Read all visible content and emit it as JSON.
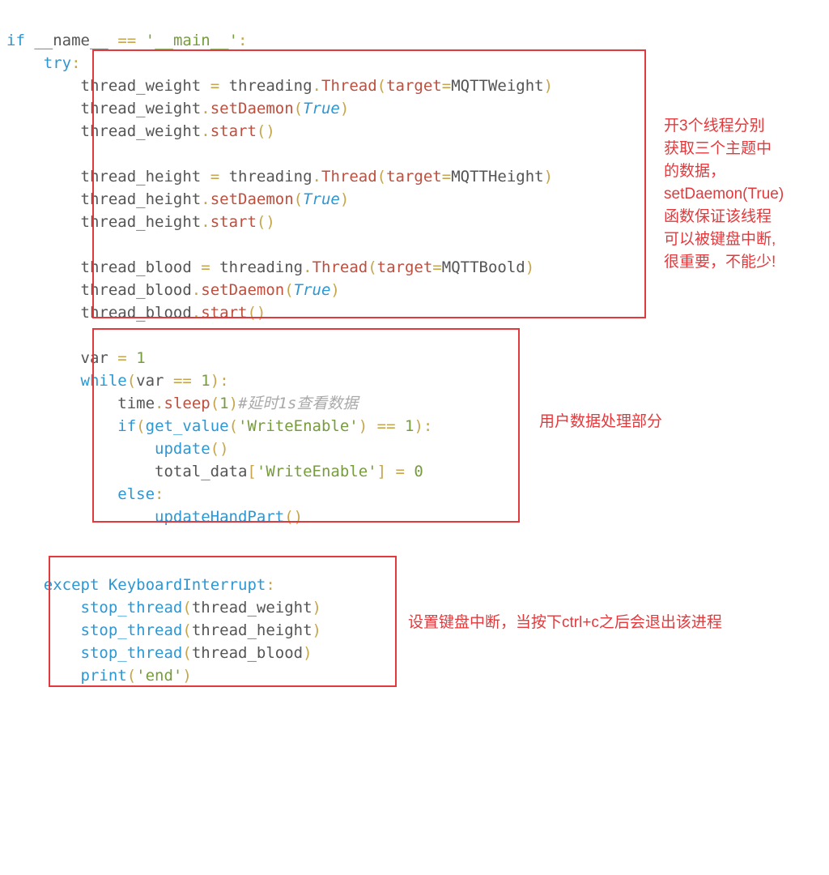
{
  "code": {
    "l01_if": "if",
    "l01_name": "__name__",
    "l01_eq": "==",
    "l01_main": "'__main__'",
    "l01_colon": ":",
    "l02_try": "try",
    "l02_colon": ":",
    "l03_tw": "thread_weight",
    "l03_eqB": "=",
    "l03_thrd": "threading",
    "l03_dot": ".",
    "l03_Thread": "Thread",
    "l03_lp": "(",
    "l03_target": "target",
    "l03_eq2": "=",
    "l03_fn": "MQTTWeight",
    "l03_rp": ")",
    "l04_tw": "thread_weight",
    "l04_dot": ".",
    "l04_sd": "setDaemon",
    "l04_lp": "(",
    "l04_true": "True",
    "l04_rp": ")",
    "l05_tw": "thread_weight",
    "l05_dot": ".",
    "l05_start": "start",
    "l05_lp": "(",
    "l05_rp": ")",
    "l07_th": "thread_height",
    "l07_eqB": "=",
    "l07_thrd": "threading",
    "l07_dot": ".",
    "l07_Thread": "Thread",
    "l07_lp": "(",
    "l07_target": "target",
    "l07_eq2": "=",
    "l07_fn": "MQTTHeight",
    "l07_rp": ")",
    "l08_th": "thread_height",
    "l08_dot": ".",
    "l08_sd": "setDaemon",
    "l08_lp": "(",
    "l08_true": "True",
    "l08_rp": ")",
    "l09_th": "thread_height",
    "l09_dot": ".",
    "l09_start": "start",
    "l09_lp": "(",
    "l09_rp": ")",
    "l11_tb": "thread_blood",
    "l11_eqB": "=",
    "l11_thrd": "threading",
    "l11_dot": ".",
    "l11_Thread": "Thread",
    "l11_lp": "(",
    "l11_target": "target",
    "l11_eq2": "=",
    "l11_fn": "MQTTBoold",
    "l11_rp": ")",
    "l12_tb": "thread_blood",
    "l12_dot": ".",
    "l12_sd": "setDaemon",
    "l12_lp": "(",
    "l12_true": "True",
    "l12_rp": ")",
    "l13_tb": "thread_blood",
    "l13_dot": ".",
    "l13_start": "start",
    "l13_lp": "(",
    "l13_rp": ")",
    "l15_var": "var",
    "l15_eq": "=",
    "l15_one": "1",
    "l16_while": "while",
    "l16_lp": "(",
    "l16_var": "var",
    "l16_eq": "==",
    "l16_one": "1",
    "l16_rp": ")",
    "l16_colon": ":",
    "l17_time": "time",
    "l17_dot": ".",
    "l17_sleep": "sleep",
    "l17_lp": "(",
    "l17_one": "1",
    "l17_rp": ")",
    "l17_cmt": "#延时1s查看数据",
    "l18_if": "if",
    "l18_lp": "(",
    "l18_gv": "get_value",
    "l18_lp2": "(",
    "l18_we": "'WriteEnable'",
    "l18_rp2": ")",
    "l18_eq": "==",
    "l18_one": "1",
    "l18_rp": ")",
    "l18_colon": ":",
    "l19_upd": "update",
    "l19_lp": "(",
    "l19_rp": ")",
    "l20_td": "total_data",
    "l20_lb": "[",
    "l20_we": "'WriteEnable'",
    "l20_rb": "]",
    "l20_eq": "=",
    "l20_zero": "0",
    "l21_else": "else",
    "l21_colon": ":",
    "l22_uhp": "updateHandPart",
    "l22_lp": "(",
    "l22_rp": ")",
    "l25_except": "except",
    "l25_ki": "KeyboardInterrupt",
    "l25_colon": ":",
    "l26_st": "stop_thread",
    "l26_lp": "(",
    "l26_arg": "thread_weight",
    "l26_rp": ")",
    "l27_st": "stop_thread",
    "l27_lp": "(",
    "l27_arg": "thread_height",
    "l27_rp": ")",
    "l28_st": "stop_thread",
    "l28_lp": "(",
    "l28_arg": "thread_blood",
    "l28_rp": ")",
    "l29_print": "print",
    "l29_lp": "(",
    "l29_end": "'end'",
    "l29_rp": ")"
  },
  "annotations": {
    "box1_text": "开3个线程分别\n获取三个主题中\n的数据，\nsetDaemon(True)\n函数保证该线程\n可以被键盘中断,\n很重要，不能少!",
    "box2_text": "用户数据处理部分",
    "box3_text": "设置键盘中断，当按下ctrl+c之后会退出该进程"
  }
}
